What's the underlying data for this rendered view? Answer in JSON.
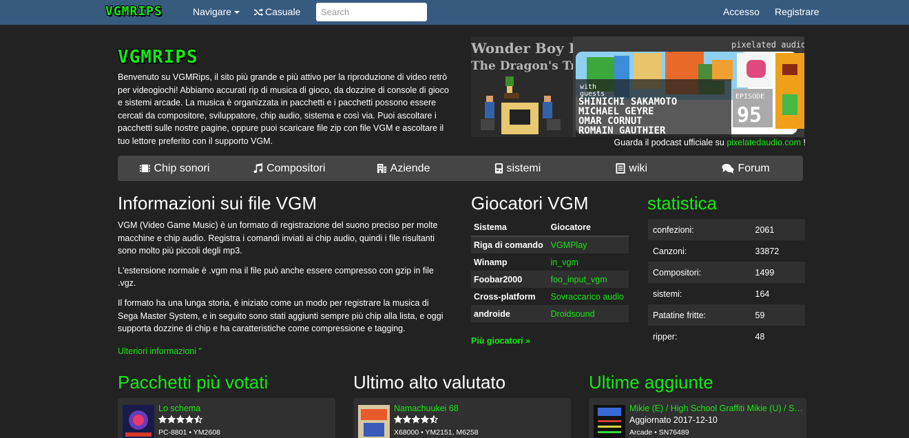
{
  "nav": {
    "brand": "VGMRIPS",
    "browse": "Navigare",
    "random": "Casuale",
    "search_placeholder": "Search",
    "login": "Accesso",
    "register": "Registrare"
  },
  "intro": {
    "logo": "VGMRIPS",
    "text": "Benvenuto su VGMRips, il sito più grande e più attivo per la riproduzione di video retrò per videogiochi! Abbiamo accurati rip di musica di gioco, da dozzine di console di gioco e sistemi arcade. La musica è organizzata in pacchetti e i pacchetti possono essere cercati da compositore, sviluppatore, chip audio, sistema e così via. Puoi ascoltare i pacchetti sulle nostre pagine, oppure puoi scaricare file zip con file VGM e ascoltare il tuo lettore preferito con il supporto VGM.",
    "podcast_prefix": "Guarda il podcast ufficiale su",
    "podcast_link": "pixelatedaudio.com",
    "podcast_suffix": "!"
  },
  "banner": {
    "title_1": "Wonder Boy III",
    "title_2": "The Dragon's Trap",
    "brand": "pixelated audio",
    "with": "with",
    "guests": "guests",
    "guest_1": "SHINICHI SAKAMOTO",
    "guest_2": "MICHAEL GEYRE",
    "guest_3": "OMAR CORNUT",
    "guest_4": "ROMAIN GAUTHIER",
    "episode_label": "EPISODE",
    "episode_num": "95"
  },
  "categories": [
    {
      "label": "Chip sonori",
      "icon": "chip-icon"
    },
    {
      "label": "Compositori",
      "icon": "music-icon"
    },
    {
      "label": "Aziende",
      "icon": "building-icon"
    },
    {
      "label": "sistemi",
      "icon": "console-icon"
    },
    {
      "label": "wiki",
      "icon": "list-icon"
    },
    {
      "label": "Forum",
      "icon": "comments-icon"
    }
  ],
  "vgm_info": {
    "heading": "Informazioni sui file VGM",
    "p1": "VGM (Video Game Music) è un formato di registrazione del suono preciso per molte macchine e chip audio. Registra i comandi inviati ai chip audio, quindi i file risultanti sono molto più piccoli degli mp3.",
    "p2": "L'estensione normale è .vgm ma il file può anche essere compresso con gzip in file .vgz.",
    "p3": "Il formato ha una lunga storia, è iniziato come un modo per registrare la musica di Sega Master System, e in seguito sono stati aggiunti sempre più chip alla lista, e oggi supporta dozzine di chip e ha caratteristiche come compressione e tagging.",
    "more": "Ulteriori informazioni \""
  },
  "players": {
    "heading": "Giocatori VGM",
    "col_system": "Sistema",
    "col_player": "Giocatore",
    "rows": [
      {
        "system": "Riga di comando",
        "player": "VGMPlay"
      },
      {
        "system": "Winamp",
        "player": "in_vgm"
      },
      {
        "system": "Foobar2000",
        "player": "foo_input_vgm"
      },
      {
        "system": "Cross-platform",
        "player": "Sovraccarico audio"
      },
      {
        "system": "androide",
        "player": "Droidsound"
      }
    ],
    "more": "Più giocatori »"
  },
  "stats": {
    "heading": "statistica",
    "rows": [
      {
        "label": "confezioni:",
        "value": "2061"
      },
      {
        "label": "Canzoni:",
        "value": "33872"
      },
      {
        "label": "Compositori:",
        "value": "1499"
      },
      {
        "label": "sistemi:",
        "value": "164"
      },
      {
        "label": "Patatine fritte:",
        "value": "59"
      },
      {
        "label": "ripper:",
        "value": "48"
      }
    ]
  },
  "top_rated": {
    "heading": "Pacchetti più votati",
    "title": "Lo schema",
    "rating": 4.5,
    "meta": "PC-8801 • YM2608"
  },
  "latest_rated": {
    "heading": "Ultimo alto valutato",
    "title": "Namachuukei 68",
    "rating": 4.5,
    "meta": "X68000 • YM2151, M6258"
  },
  "latest_added": {
    "heading": "Ultime aggiunte",
    "title": "Mikie (E) / High School Graffiti Mikie (U) / Shinnyuushain Tooru-kun (J)",
    "subtitle": "Aggiornato 2017-12-10",
    "meta": "Arcade • SN76489"
  },
  "colors": {
    "accent": "#15e815",
    "navbar": "#375a7f",
    "background": "#222222",
    "panel": "#464545"
  }
}
